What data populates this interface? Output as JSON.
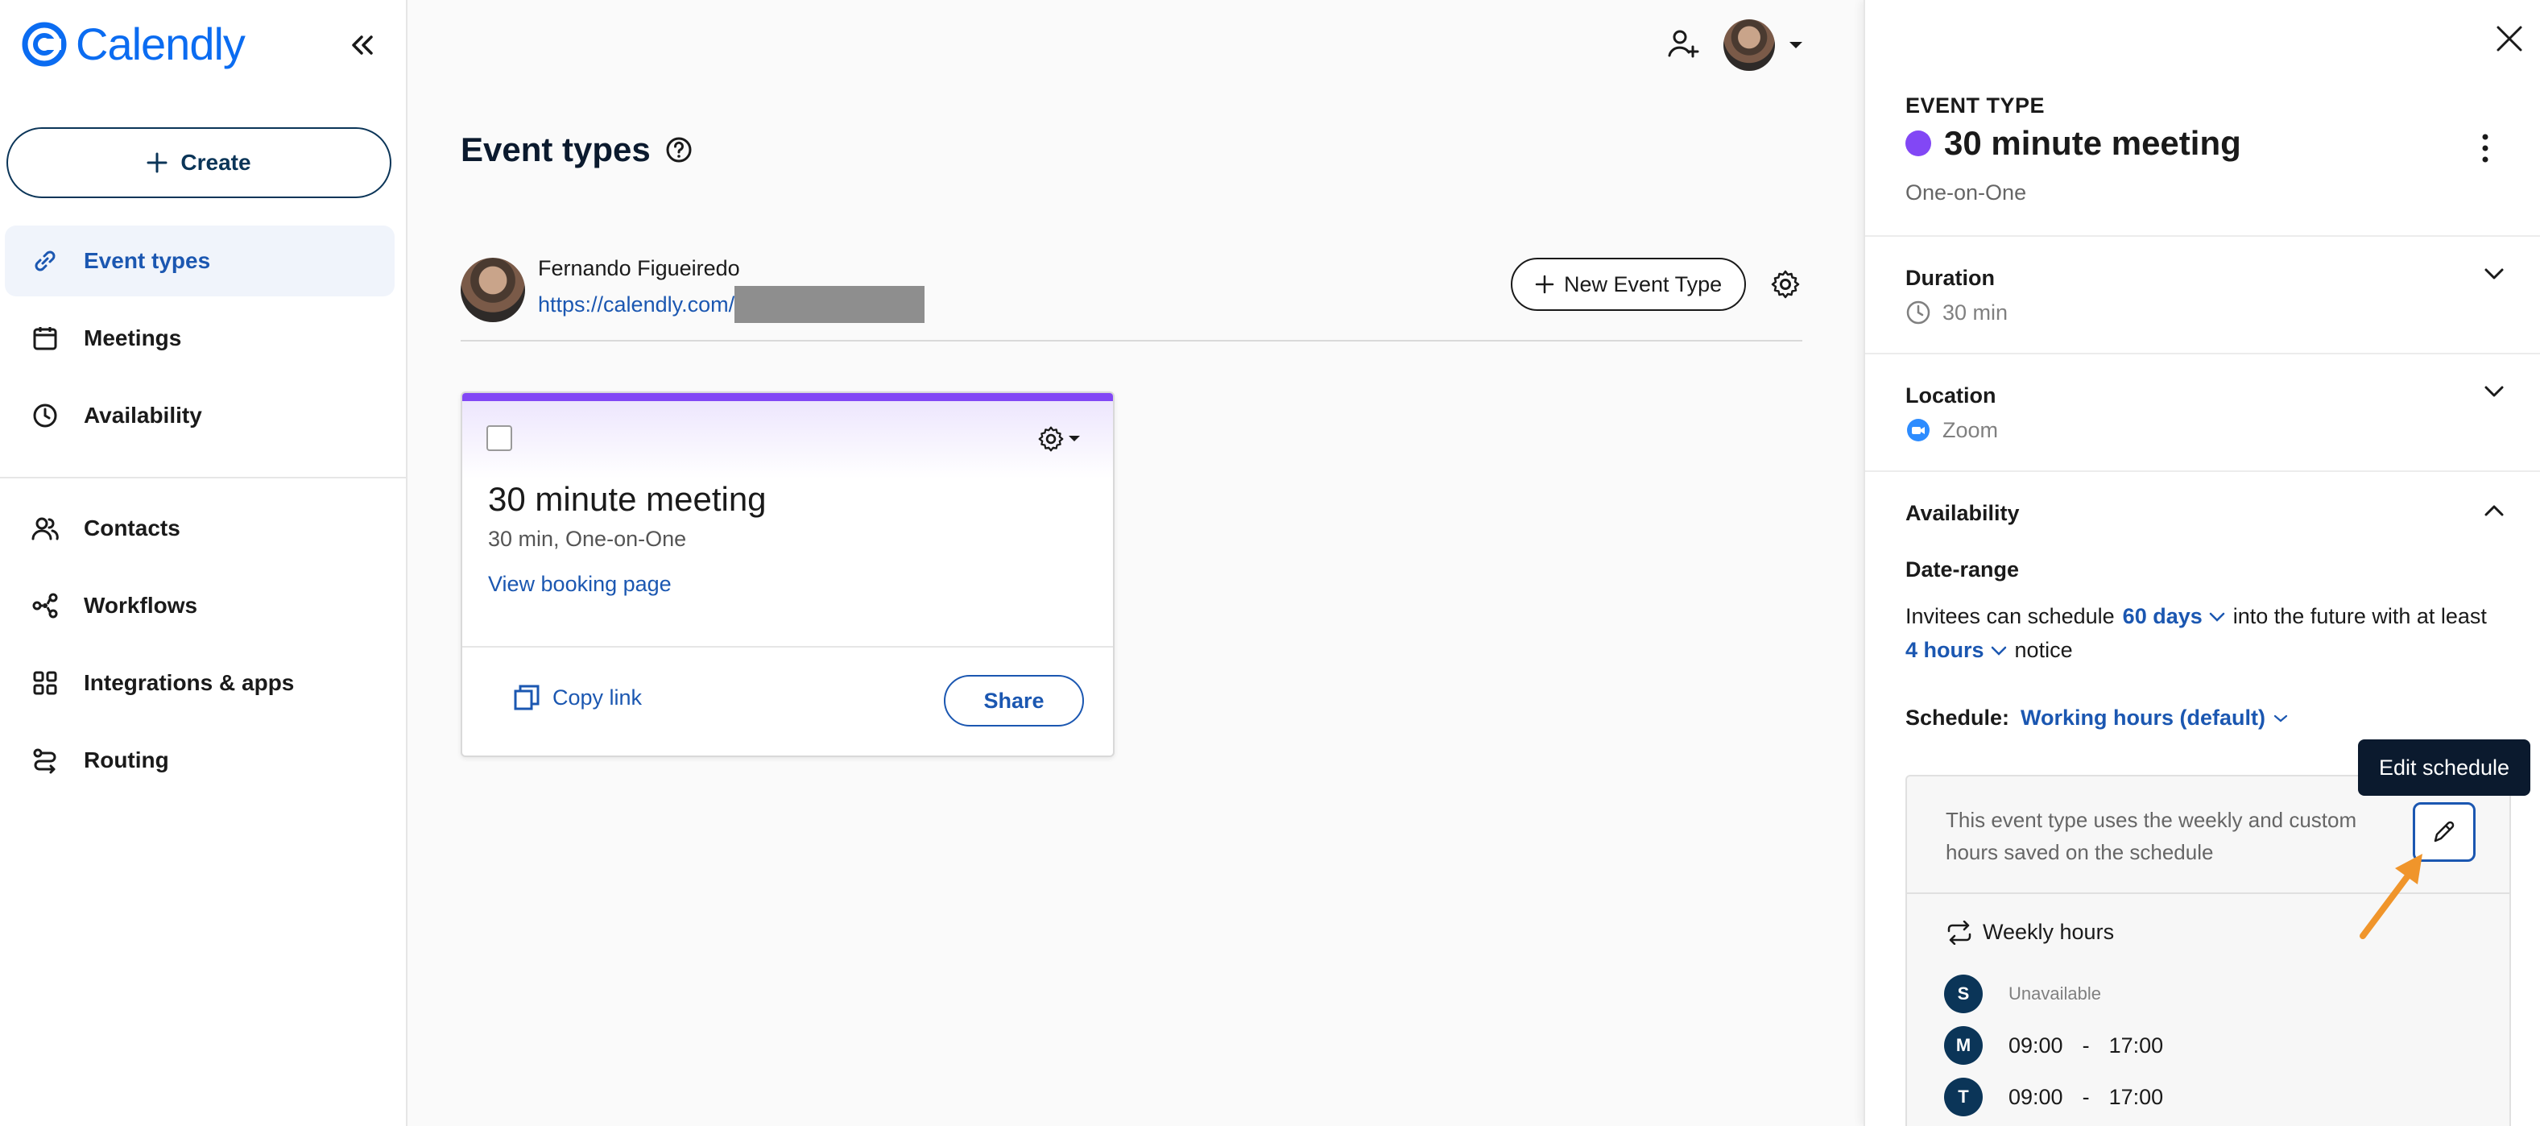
{
  "brand": {
    "name": "Calendly",
    "color": "#0b6cf1"
  },
  "sidebar": {
    "create_label": "Create",
    "items": [
      {
        "label": "Event types",
        "icon": "link-icon",
        "active": true
      },
      {
        "label": "Meetings",
        "icon": "calendar-icon"
      },
      {
        "label": "Availability",
        "icon": "clock-icon"
      },
      {
        "label": "Contacts",
        "icon": "contacts-icon"
      },
      {
        "label": "Workflows",
        "icon": "workflow-icon"
      },
      {
        "label": "Integrations & apps",
        "icon": "grid-icon"
      },
      {
        "label": "Routing",
        "icon": "routing-icon"
      }
    ]
  },
  "main": {
    "title": "Event types",
    "user": {
      "name": "Fernando Figueiredo",
      "url": "https://calendly.com/"
    },
    "new_event_label": "New Event Type",
    "card": {
      "title": "30 minute meeting",
      "subtitle": "30 min, One-on-One",
      "link": "View booking page",
      "copy_label": "Copy link",
      "share_label": "Share",
      "color": "#8247f5"
    }
  },
  "panel": {
    "label": "EVENT TYPE",
    "title": "30 minute meeting",
    "subtitle": "One-on-One",
    "duration": {
      "title": "Duration",
      "value": "30 min"
    },
    "location": {
      "title": "Location",
      "value": "Zoom"
    },
    "availability": {
      "title": "Availability",
      "date_range_title": "Date-range",
      "line1_prefix": "Invitees can schedule",
      "days_value": "60 days",
      "line1_suffix": "into the future with at least",
      "hours_value": "4 hours",
      "line2_suffix": "notice",
      "schedule_key": "Schedule:",
      "schedule_value": "Working hours (default)",
      "tooltip": "Edit schedule",
      "note": "This event type uses the weekly and custom hours saved on the schedule",
      "weekly_label": "Weekly hours",
      "days": [
        {
          "letter": "S",
          "status": "Unavailable"
        },
        {
          "letter": "M",
          "start": "09:00",
          "sep": "-",
          "end": "17:00"
        },
        {
          "letter": "T",
          "start": "09:00",
          "sep": "-",
          "end": "17:00"
        }
      ]
    }
  }
}
